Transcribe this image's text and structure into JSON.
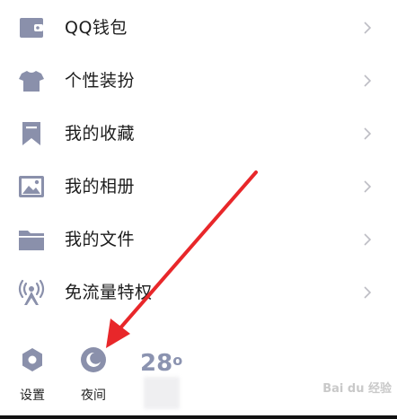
{
  "menu": {
    "items": [
      {
        "label": "QQ钱包",
        "icon": "wallet-icon"
      },
      {
        "label": "个性装扮",
        "icon": "tshirt-icon"
      },
      {
        "label": "我的收藏",
        "icon": "bookmark-icon"
      },
      {
        "label": "我的相册",
        "icon": "photo-icon"
      },
      {
        "label": "我的文件",
        "icon": "folder-icon"
      },
      {
        "label": "免流量特权",
        "icon": "signal-tower-icon"
      }
    ]
  },
  "bottom_bar": {
    "settings_label": "设置",
    "night_label": "夜间",
    "temperature": "28",
    "degree": "o"
  },
  "colors": {
    "icon": "#8a90ab",
    "chevron": "#bdbdc4",
    "annotation_arrow": "#e8272a"
  }
}
